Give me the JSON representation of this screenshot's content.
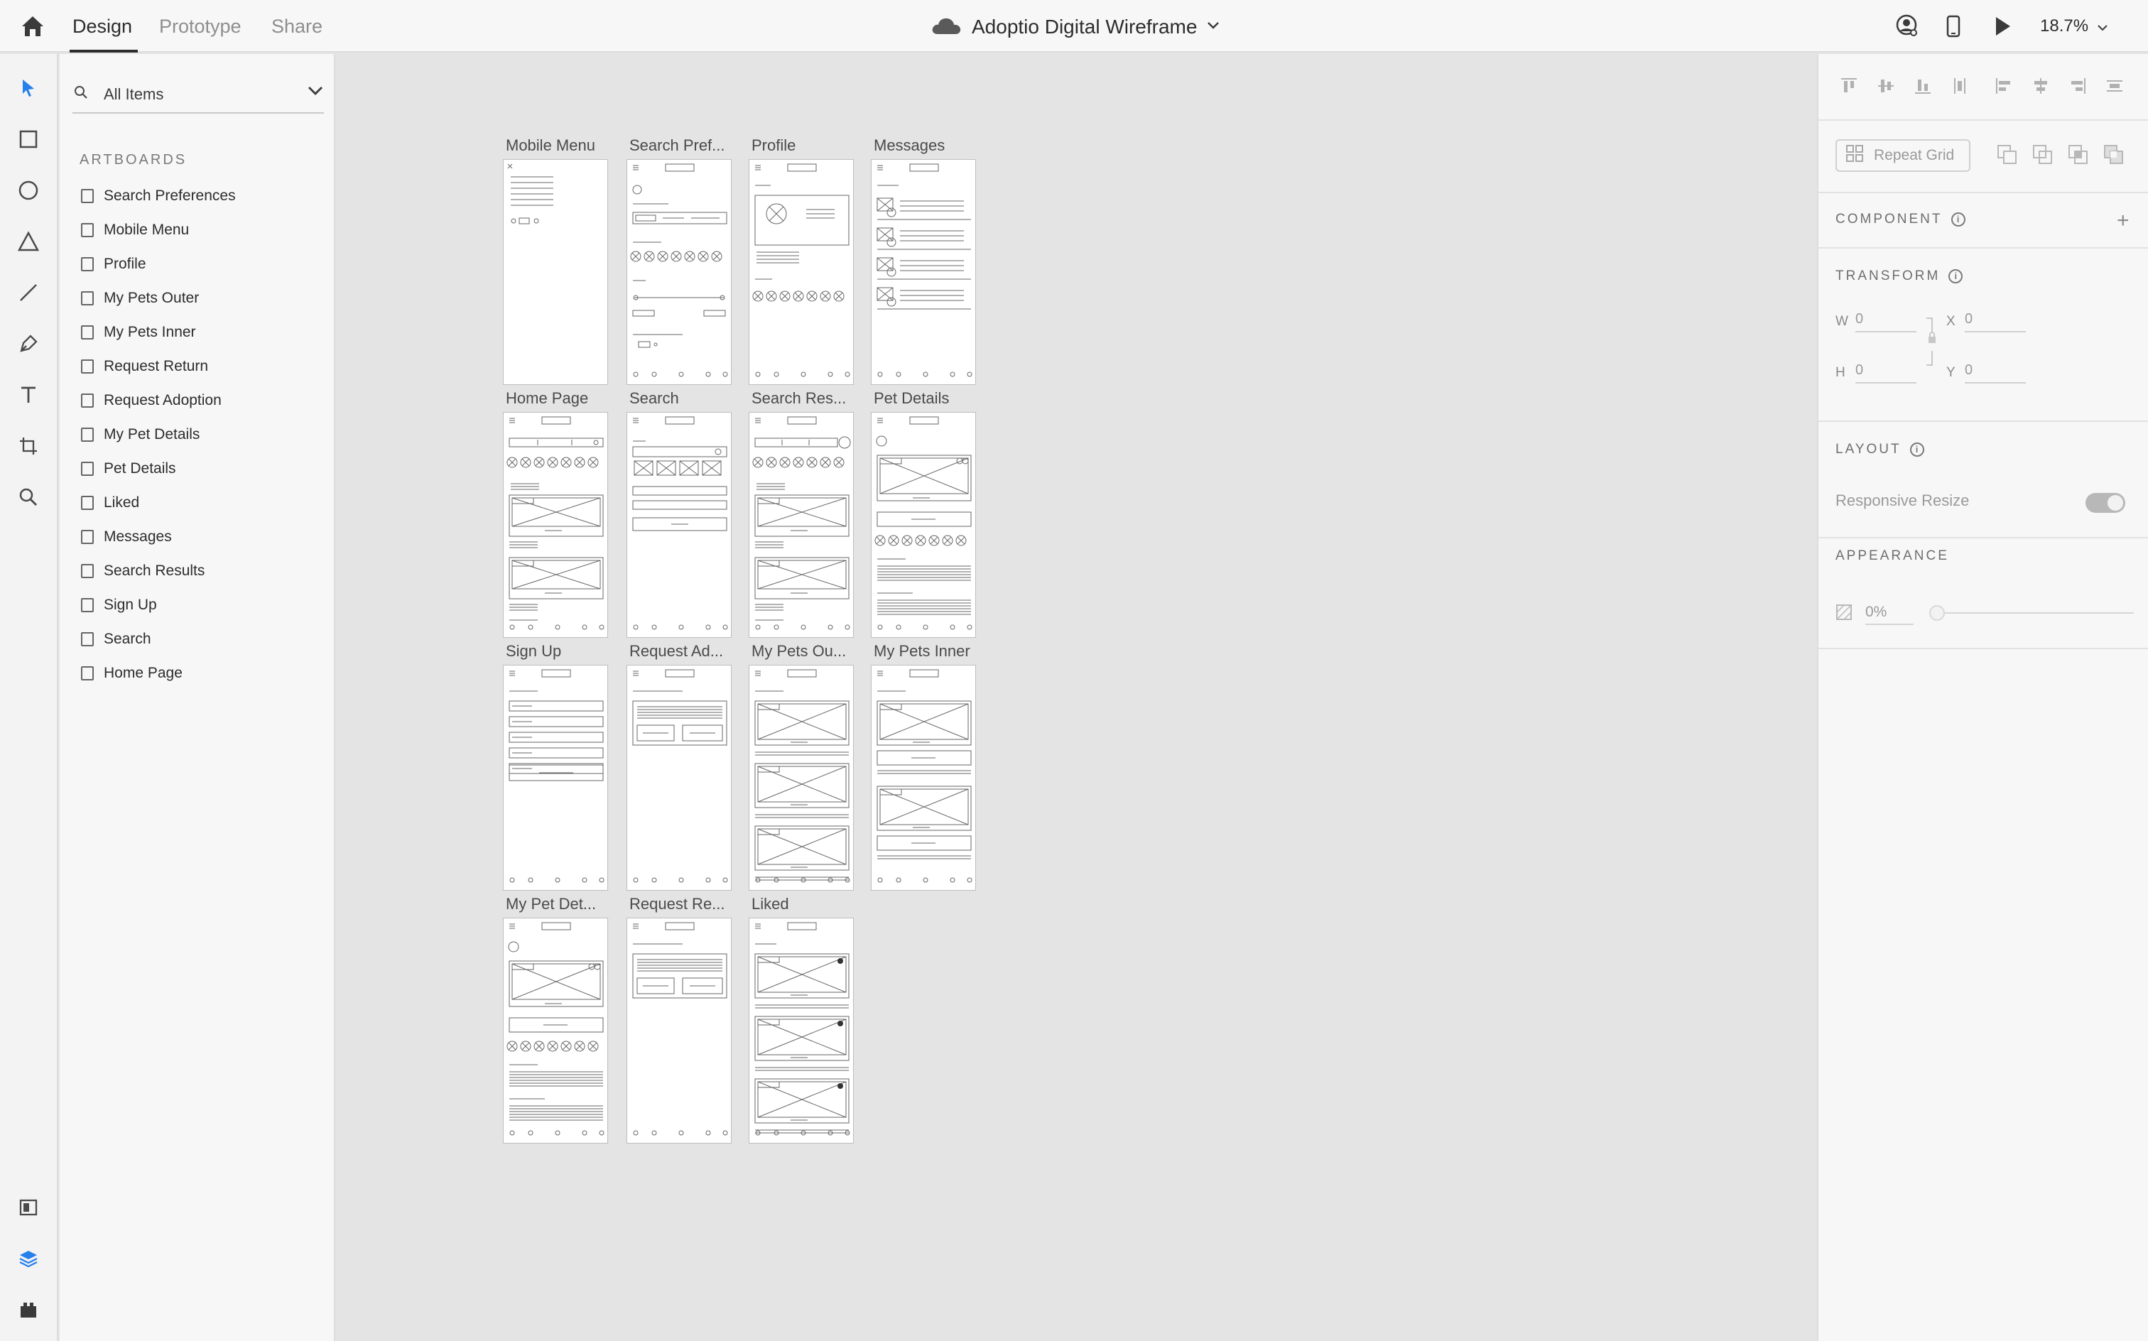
{
  "topbar": {
    "tabs": [
      {
        "label": "Design",
        "active": true
      },
      {
        "label": "Prototype",
        "active": false
      },
      {
        "label": "Share",
        "active": false
      }
    ],
    "document_title": "Adoptio Digital Wireframe",
    "zoom": "18.7%",
    "icons": [
      "home-icon",
      "cloud-icon",
      "chevron-down-icon",
      "user-icon",
      "mobile-preview-icon",
      "play-icon"
    ]
  },
  "toolrail": {
    "tools": [
      "select-tool-icon",
      "rectangle-tool-icon",
      "ellipse-tool-icon",
      "polygon-tool-icon",
      "line-tool-icon",
      "pen-tool-icon",
      "text-tool-icon",
      "artboard-tool-icon",
      "zoom-tool-icon"
    ],
    "bottom": [
      "assets-icon",
      "layers-icon",
      "plugins-icon"
    ],
    "active_color": "#2680eb"
  },
  "layers": {
    "search_value": "All Items",
    "section_label": "ARTBOARDS",
    "items": [
      "Search Preferences",
      "Mobile Menu",
      "Profile",
      "My Pets Outer",
      "My Pets Inner",
      "Request Return",
      "Request Adoption",
      "My Pet Details",
      "Pet Details",
      "Liked",
      "Messages",
      "Search Results",
      "Sign Up",
      "Search",
      "Home Page"
    ]
  },
  "canvas": {
    "artboards": [
      {
        "label": "Mobile Menu",
        "kind": "menu"
      },
      {
        "label": "Search Pref...",
        "kind": "prefs"
      },
      {
        "label": "Profile",
        "kind": "profile"
      },
      {
        "label": "Messages",
        "kind": "messages"
      },
      {
        "label": "Home Page",
        "kind": "home"
      },
      {
        "label": "Search",
        "kind": "search"
      },
      {
        "label": "Search Res...",
        "kind": "results"
      },
      {
        "label": "Pet Details",
        "kind": "details"
      },
      {
        "label": "Sign Up",
        "kind": "signup"
      },
      {
        "label": "Request Ad...",
        "kind": "request"
      },
      {
        "label": "My Pets Ou...",
        "kind": "mypets"
      },
      {
        "label": "My Pets Inner",
        "kind": "mypetsinner"
      },
      {
        "label": "My Pet Det...",
        "kind": "details"
      },
      {
        "label": "Request Re...",
        "kind": "request"
      },
      {
        "label": "Liked",
        "kind": "liked"
      }
    ]
  },
  "props": {
    "repeat_grid": "Repeat Grid",
    "component": "COMPONENT",
    "transform": "TRANSFORM",
    "w_label": "W",
    "w_value": "0",
    "x_label": "X",
    "x_value": "0",
    "h_label": "H",
    "h_value": "0",
    "y_label": "Y",
    "y_value": "0",
    "layout": "LAYOUT",
    "responsive_resize": "Responsive Resize",
    "responsive_resize_on": true,
    "appearance": "APPEARANCE",
    "opacity": "0%"
  }
}
